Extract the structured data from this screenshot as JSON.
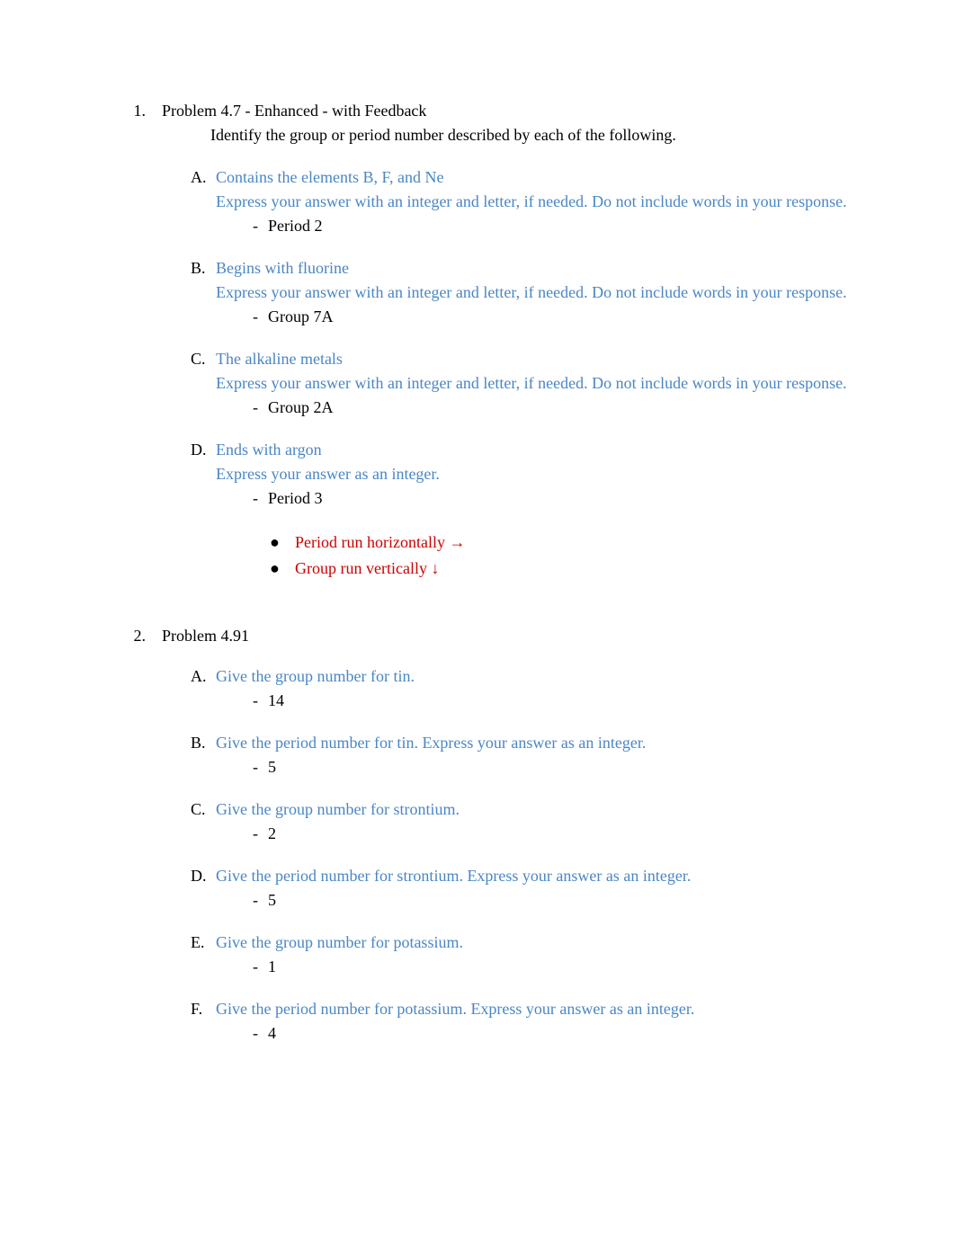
{
  "problems": [
    {
      "num_marker": "1.",
      "title": "Problem 4.7 - Enhanced - with Feedback",
      "intro": "Identify the group or period number described by each of the following.",
      "parts": [
        {
          "marker": "A.",
          "prompt": "Contains the elements B, F, and Ne",
          "instruction": "Express your answer with an integer and letter, if needed. Do not include words in your response.",
          "answer_marker": "-",
          "answer": "Period 2"
        },
        {
          "marker": "B.",
          "prompt": "Begins with fluorine",
          "instruction": "Express your answer with an integer and letter, if needed. Do not include words in your response.",
          "answer_marker": "-",
          "answer": "Group 7A"
        },
        {
          "marker": "C.",
          "prompt": "The alkaline metals",
          "instruction": "Express your answer with an integer and letter, if needed. Do not include words in your response.",
          "answer_marker": "-",
          "answer": "Group 2A"
        },
        {
          "marker": "D.",
          "prompt": "Ends with argon",
          "instruction": "Express your answer as an integer.",
          "answer_marker": "-",
          "answer": "Period 3"
        }
      ],
      "notes": [
        {
          "marker": "●",
          "text": "Period run horizontally →"
        },
        {
          "marker": "●",
          "text": "Group run vertically ↓"
        }
      ]
    },
    {
      "num_marker": "2.",
      "title": "Problem 4.91",
      "parts": [
        {
          "marker": "A.",
          "prompt": "Give the group number for tin.",
          "answer_marker": "-",
          "answer": "14"
        },
        {
          "marker": "B.",
          "prompt": "Give the period number for tin. Express your answer as an integer.",
          "answer_marker": "-",
          "answer": "5"
        },
        {
          "marker": "C.",
          "prompt": "Give the group number for strontium.",
          "answer_marker": "-",
          "answer": "2"
        },
        {
          "marker": "D.",
          "prompt": "Give the period number for strontium. Express your answer as an integer.",
          "answer_marker": "-",
          "answer": "5"
        },
        {
          "marker": "E.",
          "prompt": "Give the group number for potassium.",
          "answer_marker": "-",
          "answer": "1"
        },
        {
          "marker": "F.",
          "prompt": "Give the period number for potassium. Express your answer as an integer.",
          "answer_marker": "-",
          "answer": "4"
        }
      ]
    }
  ]
}
